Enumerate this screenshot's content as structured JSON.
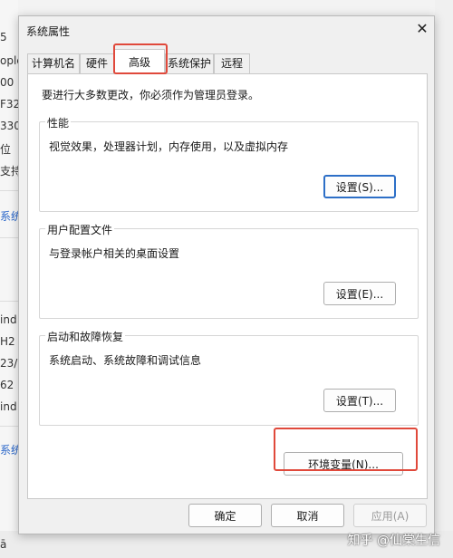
{
  "background": {
    "left_fragments": [
      "5",
      "ople",
      "00 (",
      "F32",
      "330",
      "位",
      "支持",
      "系统",
      "ind",
      "H2",
      "23/",
      "62",
      "ind",
      "系统"
    ],
    "bottom_fragment": "ā",
    "watermark": "知乎 @仙棠生信"
  },
  "dialog": {
    "title": "系统属性",
    "close_glyph": "✕",
    "tabs": [
      {
        "label": "计算机名"
      },
      {
        "label": "硬件"
      },
      {
        "label": "高级"
      },
      {
        "label": "系统保护"
      },
      {
        "label": "远程"
      }
    ],
    "notice": "要进行大多数更改，你必须作为管理员登录。",
    "groups": [
      {
        "title": "性能",
        "desc": "视觉效果，处理器计划，内存使用，以及虚拟内存",
        "button": "设置(S)..."
      },
      {
        "title": "用户配置文件",
        "desc": "与登录帐户相关的桌面设置",
        "button": "设置(E)..."
      },
      {
        "title": "启动和故障恢复",
        "desc": "系统启动、系统故障和调试信息",
        "button": "设置(T)..."
      }
    ],
    "env_button": "环境变量(N)...",
    "footer": {
      "ok": "确定",
      "cancel": "取消",
      "apply": "应用(A)"
    }
  }
}
